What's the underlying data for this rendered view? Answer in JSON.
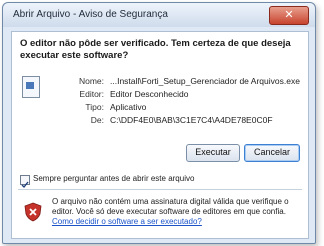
{
  "window": {
    "title": "Abrir Arquivo - Aviso de Segurança",
    "close_label": "✕"
  },
  "question": "O editor não pôde ser verificado. Tem certeza de que deseja executar este software?",
  "details": [
    {
      "label": "Nome:",
      "value": "...Install\\Forti_Setup_Gerenciador de Arquivos.exe"
    },
    {
      "label": "Editor:",
      "value": "Editor Desconhecido"
    },
    {
      "label": "Tipo:",
      "value": "Aplicativo"
    },
    {
      "label": "De:",
      "value": "C:\\DDF4E0\\BAB\\3C1E7C4\\A4DE78E0C0F"
    }
  ],
  "buttons": {
    "run": "Executar",
    "cancel": "Cancelar"
  },
  "checkbox": {
    "label": "Sempre perguntar antes de abrir este arquivo",
    "checked": true
  },
  "warning": {
    "text": "O arquivo não contém uma assinatura digital válida que verifique o editor. Você só deve executar software de editores em que confia.",
    "link": "Como decidir o software a ser executado?"
  },
  "colors": {
    "accent": "#3c7fd3",
    "close": "#c7442f",
    "link": "#1b53c9"
  }
}
